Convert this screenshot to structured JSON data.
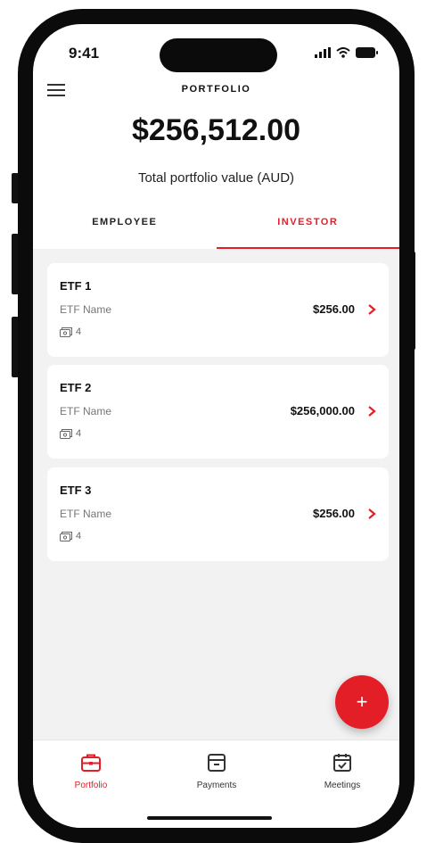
{
  "status_bar": {
    "time": "9:41"
  },
  "header": {
    "title": "PORTFOLIO"
  },
  "summary": {
    "total_value": "$256,512.00",
    "total_label": "Total portfolio value (AUD)"
  },
  "tabs": [
    {
      "label": "EMPLOYEE",
      "active": false
    },
    {
      "label": "INVESTOR",
      "active": true
    }
  ],
  "holdings": [
    {
      "title": "ETF 1",
      "subtitle": "ETF Name",
      "quantity": "4",
      "amount": "$256.00"
    },
    {
      "title": "ETF 2",
      "subtitle": "ETF Name",
      "quantity": "4",
      "amount": "$256,000.00"
    },
    {
      "title": "ETF 3",
      "subtitle": "ETF Name",
      "quantity": "4",
      "amount": "$256.00"
    }
  ],
  "fab": {
    "label": "+"
  },
  "bottom_nav": [
    {
      "label": "Portfolio",
      "icon": "briefcase-icon",
      "active": true
    },
    {
      "label": "Payments",
      "icon": "wallet-icon",
      "active": false
    },
    {
      "label": "Meetings",
      "icon": "calendar-check-icon",
      "active": false
    }
  ],
  "colors": {
    "accent": "#e41e26",
    "list_background": "#f2f2f2",
    "text": "#111111",
    "muted": "#777777"
  }
}
